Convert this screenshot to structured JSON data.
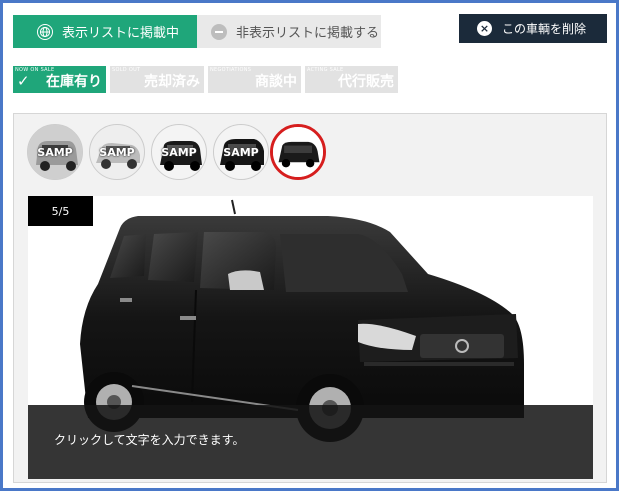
{
  "header": {
    "listed_tab": {
      "label": "表示リストに掲載中",
      "icon": "globe-icon"
    },
    "hidden_tab": {
      "label": "非表示リストに掲載する",
      "icon": "minus-circle-icon"
    },
    "delete_button": {
      "label": "この車輌を削除",
      "icon": "close-circle-icon"
    }
  },
  "status_tags": [
    {
      "sub": "NOW ON SALE",
      "label": "在庫有り",
      "active": true,
      "icon": "check-icon"
    },
    {
      "sub": "SOLD OUT",
      "label": "売却済み",
      "active": false
    },
    {
      "sub": "NEGOTIATIONS",
      "label": "商談中",
      "active": false
    },
    {
      "sub": "ACTING SALE",
      "label": "代行販売",
      "active": false
    }
  ],
  "gallery": {
    "thumbnails": [
      {
        "watermark": "SAMP",
        "selected": false
      },
      {
        "watermark": "SAMP",
        "selected": false
      },
      {
        "watermark": "SAMP",
        "selected": false
      },
      {
        "watermark": "SAMP",
        "selected": false
      },
      {
        "watermark": "",
        "selected": true
      }
    ],
    "counter": "5/5",
    "caption": "クリックして文字を入力できます。"
  },
  "colors": {
    "accent": "#1fa67a",
    "dark_button": "#1b2a3a",
    "selected_ring": "#d61e1e",
    "window_border": "#4a78c8"
  }
}
